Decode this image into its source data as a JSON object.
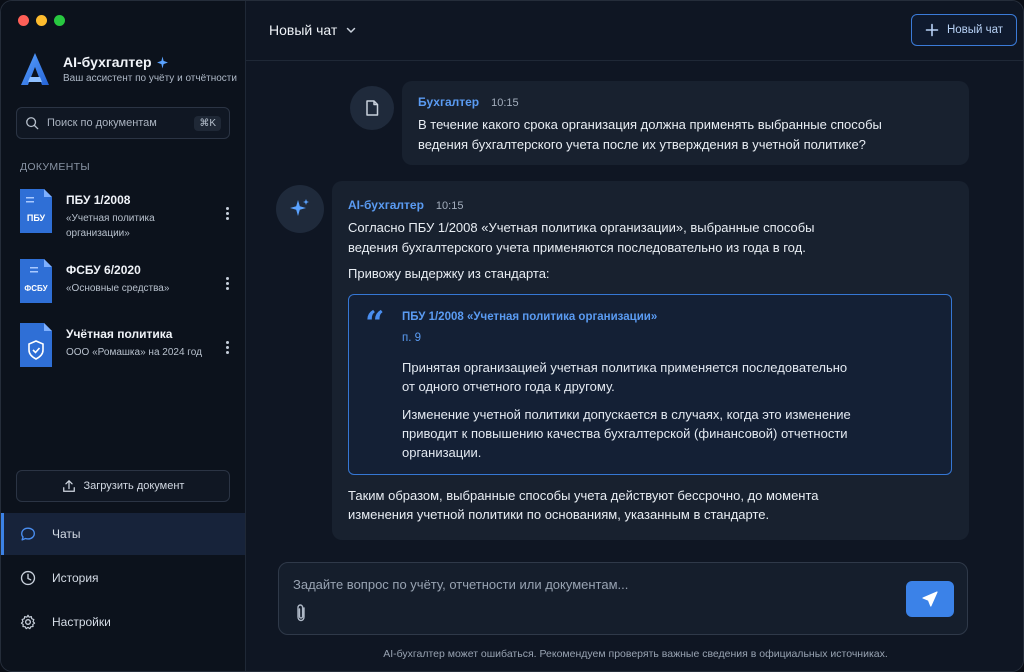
{
  "sidebar": {
    "brand_title": "AI-бухгалтер",
    "brand_subtitle": "Ваш ассистент по учёту и отчётности",
    "search_placeholder": "Поиск по документам",
    "search_shortcut": "⌘K",
    "documents_label": "ДОКУМЕНТЫ",
    "documents": [
      {
        "badge": "ПБУ",
        "title": "ПБУ 1/2008",
        "subtitle_line1": "«Учетная политика",
        "subtitle_line2": "организации»",
        "icon": "pbu-document-icon"
      },
      {
        "badge": "ФСБУ",
        "title": "ФСБУ 6/2020",
        "subtitle_line1": "«Основные средства»",
        "subtitle_line2": "",
        "icon": "fsbu-document-icon"
      },
      {
        "badge": "",
        "title": "Учётная политика",
        "subtitle_line1": "ООО «Ромашка» на 2024 год",
        "subtitle_line2": "",
        "icon": "shield-document-icon"
      }
    ],
    "upload_label": "Загрузить документ",
    "nav": [
      {
        "label": "Чаты",
        "icon": "chat-icon",
        "active": true
      },
      {
        "label": "История",
        "icon": "clock-icon",
        "active": false
      },
      {
        "label": "Настройки",
        "icon": "gear-icon",
        "active": false
      }
    ]
  },
  "header": {
    "chat_title": "Новый чат",
    "new_chat_label": "Новый чат"
  },
  "messages": {
    "user": {
      "author": "Бухгалтер",
      "time": "10:15",
      "text_line1": "В течение какого срока организация должна применять выбранные способы",
      "text_line2": "ведения бухгалтерского учета после их утверждения в учетной политике?"
    },
    "assistant": {
      "author": "AI-бухгалтер",
      "time": "10:15",
      "para1_line1": "Согласно ПБУ 1/2008 «Учетная политика организации», выбранные способы",
      "para1_line2": "ведения бухгалтерского учета применяются последовательно из года в год.",
      "para2": "Привожу выдержку из стандарта:",
      "quote": {
        "source": "ПБУ 1/2008 «Учетная политика организации»",
        "point": "п. 9",
        "p1_line1": "Принятая организацией учетная политика применяется последовательно",
        "p1_line2": "от одного отчетного года к другому.",
        "p2_line1": "Изменение учетной политики допускается в случаях, когда это изменение",
        "p2_line2": "приводит к повышению качества бухгалтерской (финансовой) отчетности",
        "p2_line3": "организации."
      },
      "conclusion_line1": "Таким образом, выбранные способы учета действуют бессрочно, до момента",
      "conclusion_line2": "изменения учетной политики по основаниям, указанным в стандарте."
    }
  },
  "composer": {
    "placeholder": "Задайте вопрос по учёту, отчетности или документам...",
    "disclaimer": "AI-бухгалтер может ошибаться. Рекомендуем проверять важные сведения в официальных источниках."
  },
  "colors": {
    "accent": "#3b82e8",
    "background": "#0f1623",
    "sidebar": "#0c121c",
    "bubble": "#18212f"
  }
}
